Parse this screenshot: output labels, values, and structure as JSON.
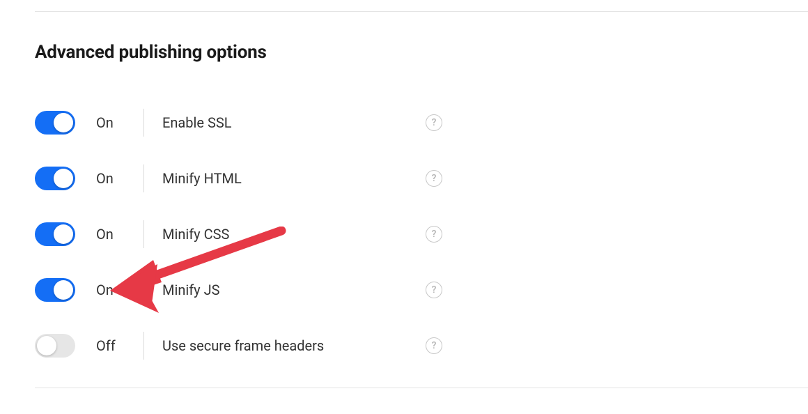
{
  "section": {
    "title": "Advanced publishing options"
  },
  "labels": {
    "on": "On",
    "off": "Off",
    "help_glyph": "?"
  },
  "options": [
    {
      "state": "on",
      "label": "Enable SSL"
    },
    {
      "state": "on",
      "label": "Minify HTML"
    },
    {
      "state": "on",
      "label": "Minify CSS"
    },
    {
      "state": "on",
      "label": "Minify JS"
    },
    {
      "state": "off",
      "label": "Use secure frame headers"
    }
  ],
  "annotation": {
    "arrow_color": "#e63946"
  }
}
